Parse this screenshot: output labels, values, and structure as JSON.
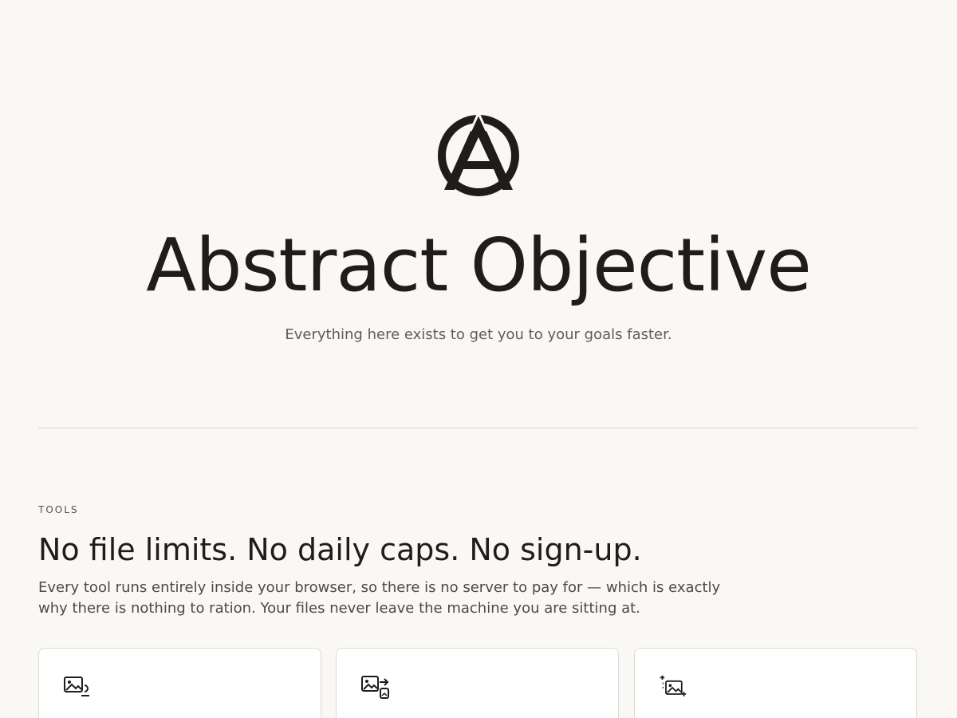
{
  "hero": {
    "logo_icon": "anarchy-circle-a-logo",
    "title": "Abstract Objective",
    "subtitle": "Everything here exists to get you to your goals faster."
  },
  "tools": {
    "eyebrow": "TOOLS",
    "title": "No file limits. No daily caps. No sign-up.",
    "description": "Every tool runs entirely inside your browser, so there is no server to pay for — which is exactly why there is nothing to ration. Your files never leave the machine you are sitting at.",
    "cards": [
      {
        "icon": "image-compress-icon"
      },
      {
        "icon": "image-convert-icon"
      },
      {
        "icon": "image-upscale-icon"
      }
    ]
  },
  "colors": {
    "background": "#f9f8f5",
    "text": "#1e1d1b",
    "muted_text": "#5f5c57",
    "divider": "#dcd9d3",
    "card": "#ffffff"
  }
}
